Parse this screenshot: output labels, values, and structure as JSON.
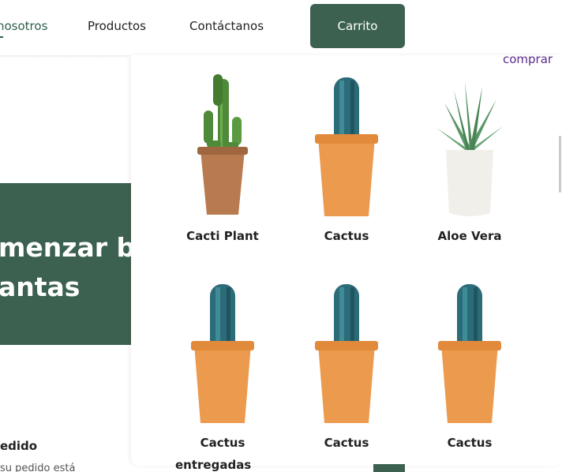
{
  "nav": {
    "items": [
      "nosotros",
      "Productos",
      "Contáctanos"
    ],
    "cart_label": "Carrito"
  },
  "hero": {
    "line1": "menzar bie",
    "line2": "antas"
  },
  "step": {
    "title": "edido",
    "desc": "su pedido está"
  },
  "panel": {
    "buy_link": "comprar",
    "products": [
      {
        "name": "Cacti Plant",
        "plant": "cactus-branching",
        "pot": "brown"
      },
      {
        "name": "Cactus",
        "plant": "cactus-blue",
        "pot": "orange"
      },
      {
        "name": "Aloe Vera",
        "plant": "aloe",
        "pot": "white"
      },
      {
        "name": "Cactus",
        "plant": "cactus-blue",
        "pot": "orange"
      },
      {
        "name": "Cactus",
        "plant": "cactus-blue",
        "pot": "orange"
      },
      {
        "name": "Cactus",
        "plant": "cactus-blue",
        "pot": "orange"
      }
    ]
  },
  "bottom": {
    "title": "entregadas"
  },
  "colors": {
    "brand_green": "#3d6150",
    "link_purple": "#5a2a8a",
    "pot_orange": "#ec9a4e",
    "pot_brown": "#b87a4f"
  }
}
